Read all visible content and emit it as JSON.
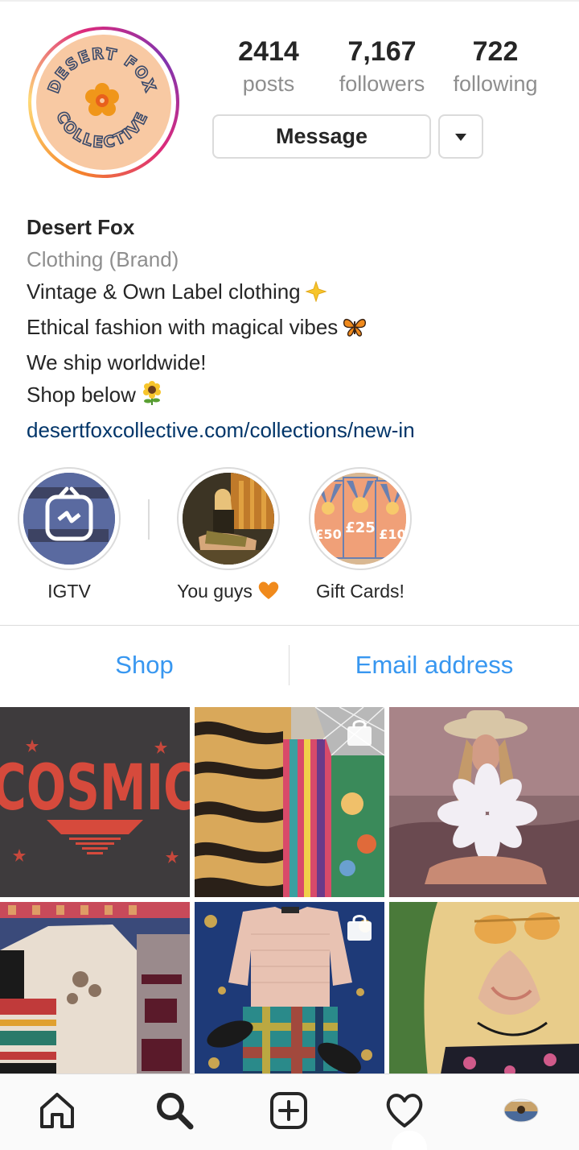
{
  "profile": {
    "stats": [
      {
        "value": "2414",
        "label": "posts"
      },
      {
        "value": "7,167",
        "label": "followers"
      },
      {
        "value": "722",
        "label": "following"
      }
    ],
    "message_label": "Message",
    "avatar_text_top": "DESERT FOX",
    "avatar_text_bottom": "COLLECTIVE"
  },
  "bio": {
    "name": "Desert Fox",
    "category": "Clothing (Brand)",
    "lines": [
      "Vintage & Own Label clothing",
      "Ethical fashion with magical vibes",
      "We ship worldwide!",
      "Shop below"
    ],
    "link": "desertfoxcollective.com/collections/new-in"
  },
  "highlights": [
    {
      "label": "IGTV"
    },
    {
      "label": "You guys"
    },
    {
      "label": "Gift Cards!"
    }
  ],
  "highlight_gift_text": [
    "£50",
    "£25",
    "£10"
  ],
  "actions": {
    "shop": "Shop",
    "email": "Email address"
  },
  "grid": {
    "tile1_text": "COSMIC"
  },
  "colors": {
    "link_blue": "#3897f0",
    "bio_link": "#003569",
    "muted": "#8e8e8e",
    "text": "#262626",
    "border": "#dbdbdb"
  },
  "icons": {
    "nav": [
      "home-icon",
      "search-icon",
      "new-post-icon",
      "heart-icon",
      "profile-avatar-icon"
    ]
  }
}
